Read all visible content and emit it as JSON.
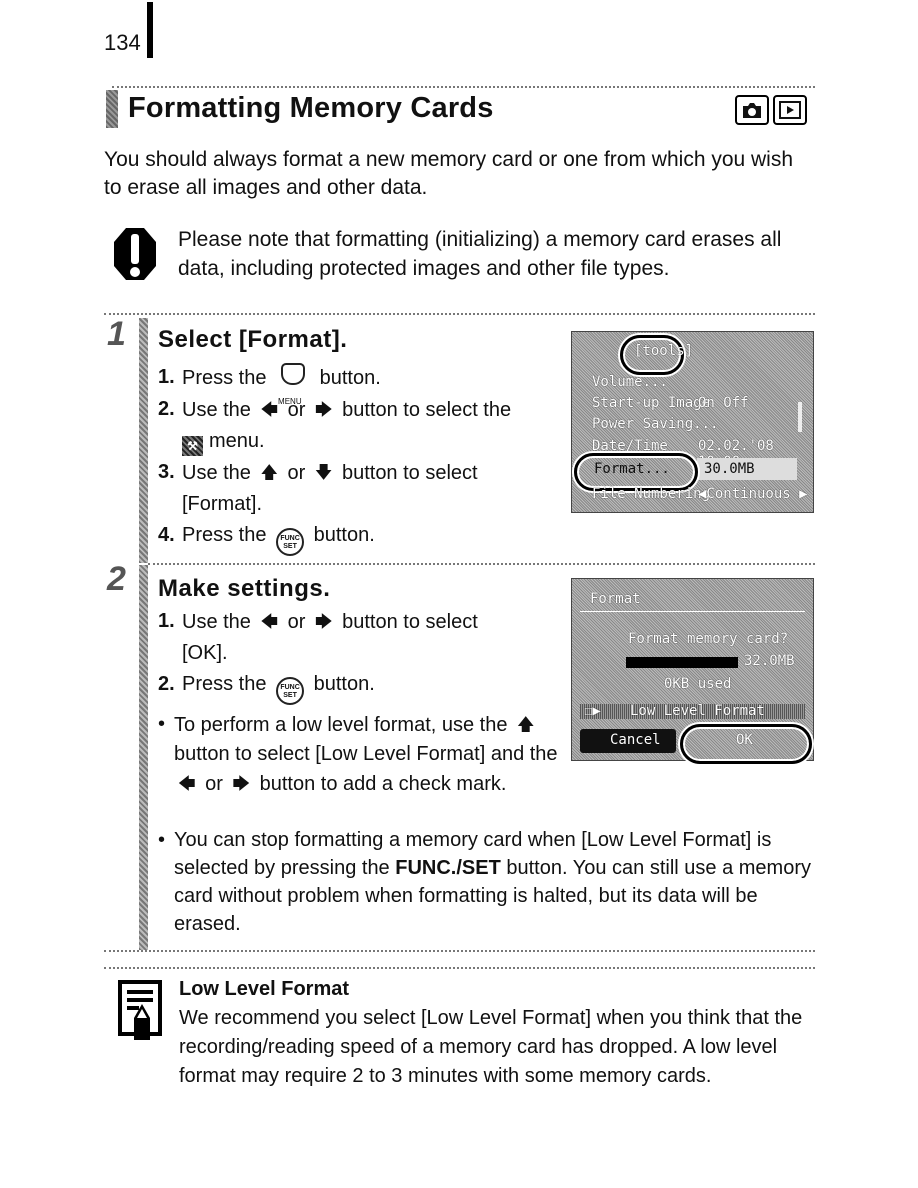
{
  "page_number": "134",
  "title": "Formatting Memory Cards",
  "mode_icons": [
    {
      "name": "camera-mode-icon",
      "glyph": "📷"
    },
    {
      "name": "playback-mode-icon",
      "glyph": "▶"
    }
  ],
  "intro": "You should always format a new memory card or one from which you wish to erase all images and other data.",
  "caution": {
    "icon": "caution-icon",
    "text": "Please note that formatting (initializing) a memory card erases all data, including protected images and other file types."
  },
  "steps": [
    {
      "number": "1",
      "title": "Select [Format].",
      "items": [
        {
          "num": "1.",
          "pre": "Press the",
          "icon": "menu-button",
          "icon_label": "MENU",
          "post": "button."
        },
        {
          "num": "2.",
          "pre": "Use the",
          "arrow1": "🡄",
          "mid": "or",
          "arrow2": "🡆",
          "post": "button to select the",
          "line2_icon": "tools-tab-icon",
          "line2": "menu."
        },
        {
          "num": "3.",
          "pre": "Use the",
          "arrow1": "🡅",
          "mid": "or",
          "arrow2": "🡇",
          "post": "button to select",
          "line2": "[Format]."
        },
        {
          "num": "4.",
          "pre": "Press the",
          "icon": "func-set-button",
          "icon_label_top": "FUNC",
          "icon_label_bottom": "SET",
          "post": "button."
        }
      ],
      "screen": {
        "tab_label": "[tools]",
        "rows": [
          {
            "label": "Volume...",
            "value": ""
          },
          {
            "label": "Start-up Image",
            "value": "On  Off"
          },
          {
            "label": "Power Saving...",
            "value": ""
          },
          {
            "label": "Date/Time",
            "value": "02.02.'08 10:00"
          },
          {
            "label": "Format...",
            "value": "30.0MB",
            "highlighted": true
          },
          {
            "label": "File Numbering",
            "value": "◀Continuous ▶"
          }
        ]
      }
    },
    {
      "number": "2",
      "title": "Make settings.",
      "items": [
        {
          "num": "1.",
          "pre": "Use the",
          "arrow1": "🡄",
          "mid": "or",
          "arrow2": "🡆",
          "post": "button to select",
          "line2": "[OK]."
        },
        {
          "num": "2.",
          "pre": "Press the",
          "icon": "func-set-button",
          "icon_label_top": "FUNC",
          "icon_label_bottom": "SET",
          "post": "button."
        }
      ],
      "bullets": [
        {
          "pre": "To perform a low level format, use the",
          "arrow_up": "🡅",
          "mid": "button to select [Low Level Format] and the",
          "arrow1": "🡄",
          "or": "or",
          "arrow2": "🡆",
          "post": "button to add a check mark."
        },
        {
          "pre": "You can stop formatting a memory card when [Low Level Format] is selected by pressing the",
          "bold": "FUNC./SET",
          "post": "button. You can still use a memory card without problem when formatting is halted, but its data will be erased."
        }
      ],
      "screen": {
        "title": "Format",
        "question": "Format memory card?",
        "capacity": "32.0MB",
        "used": "0KB used",
        "used_fraction": 0.0,
        "checkbox_label": "Low Level Format",
        "checkbox_checked": false,
        "cancel": "Cancel",
        "ok": "OK"
      }
    }
  ],
  "note": {
    "icon": "memo-icon",
    "title": "Low Level Format",
    "text": "We recommend you select [Low Level Format] when you think that the recording/reading speed of a memory card has dropped. A low level format may require 2 to 3 minutes with some memory cards."
  }
}
